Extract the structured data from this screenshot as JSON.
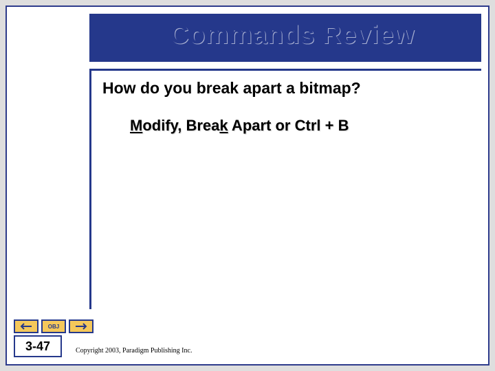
{
  "title": "Commands Review",
  "question": "How do you break apart a bitmap?",
  "answer": {
    "m_1": "M",
    "modify_rest": "odify, Brea",
    "k_1": "k",
    "rest": " Apart or Ctrl + B"
  },
  "nav": {
    "obj_label": "OBJ"
  },
  "page_number": "3-47",
  "copyright": "Copyright 2003, Paradigm Publishing Inc.",
  "colors": {
    "brand": "#25388b",
    "accent": "#f5c85a"
  }
}
